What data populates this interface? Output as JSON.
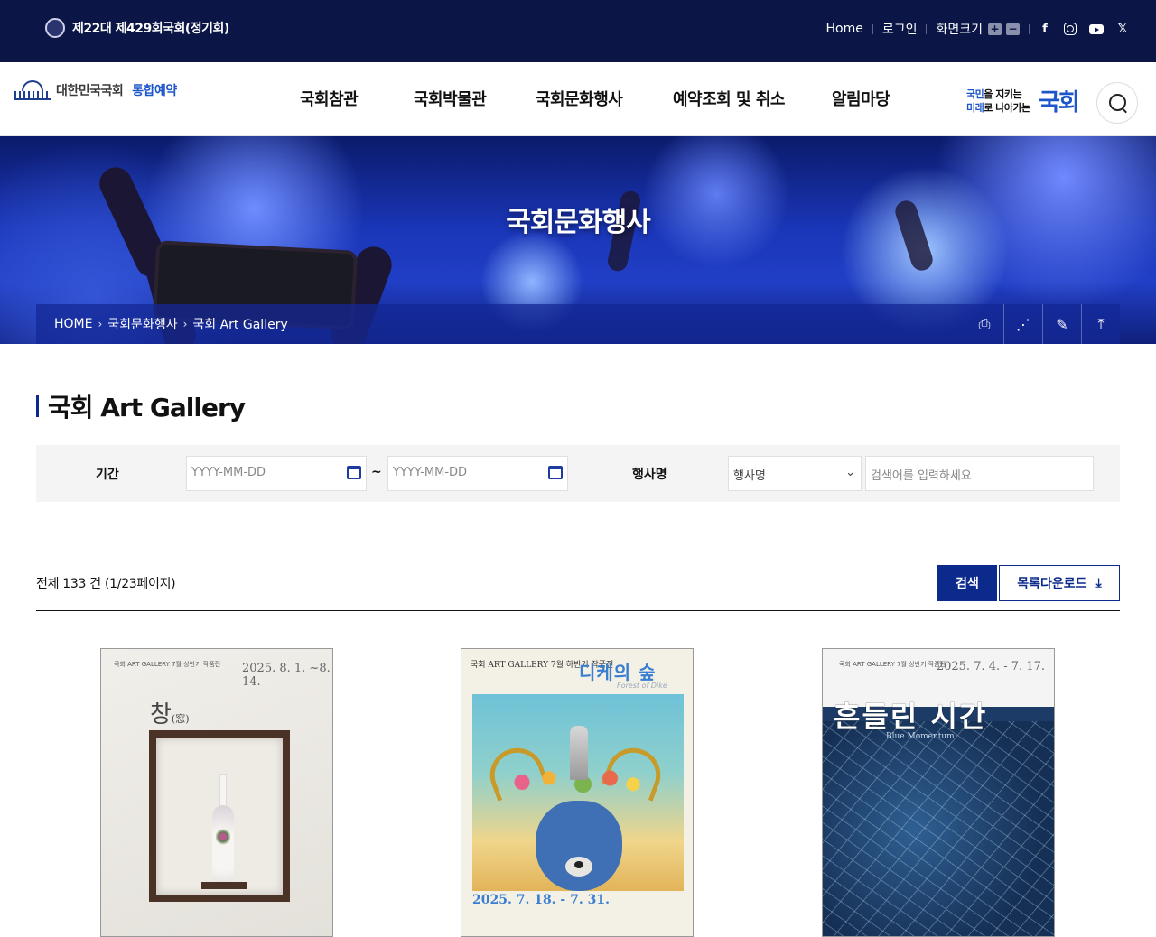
{
  "topbar": {
    "session": "제22대 제429회국회(정기회)",
    "home": "Home",
    "login": "로그인",
    "font_size": "화면크기",
    "zoom_in": "+",
    "zoom_out": "−",
    "sns": {
      "facebook": "f",
      "twitter": "𝕏"
    }
  },
  "header": {
    "logo_text": "대한민국국회",
    "logo_sub": "통합예약",
    "nav": [
      "국회참관",
      "국회박물관",
      "국회문화행사",
      "예약조회 및 취소",
      "알림마당"
    ],
    "slogan": {
      "line1_hl": "국민",
      "line1": "을 지키는",
      "line2_hl": "미래",
      "line2": "로 나아가는",
      "big": "국회"
    }
  },
  "banner": {
    "title": "국회문화행사",
    "breadcrumb": [
      "HOME",
      "국회문화행사",
      "국회 Art Gallery"
    ],
    "tools": {
      "print": "⎙",
      "share": "⋰",
      "edit": "✎",
      "top": "⤒"
    }
  },
  "page": {
    "title": "국회 Art Gallery"
  },
  "filter": {
    "period_label": "기간",
    "start_placeholder": "YYYY-MM-DD",
    "end_placeholder": "YYYY-MM-DD",
    "tilde": "~",
    "event_label": "행사명",
    "event_select": "행사명",
    "keyword_placeholder": "검색어를 입력하세요"
  },
  "results": {
    "total_text": "전체 133 건 (1/23페이지)",
    "search_button": "검색",
    "download_button": "목록다운로드",
    "download_icon": "⤓"
  },
  "posters": [
    {
      "date": "2025. 8. 1. ~8. 14.",
      "head": "국회 ART GALLERY  7월 상반기 작품전",
      "title": "창",
      "title_sub": "(窓)"
    },
    {
      "head": "국회 ART GALLERY\n7월 하반기 작품전",
      "title": "디케의 숲",
      "subtitle": "Forest of Dike",
      "date": "2025. 7. 18. - 7. 31."
    },
    {
      "head": "국회 ART GALLERY  7월 상반기 작품전",
      "date": "2025. 7. 4. - 7. 17.",
      "title": "흔들린 시간",
      "subtitle": "Blue Momentum"
    }
  ]
}
